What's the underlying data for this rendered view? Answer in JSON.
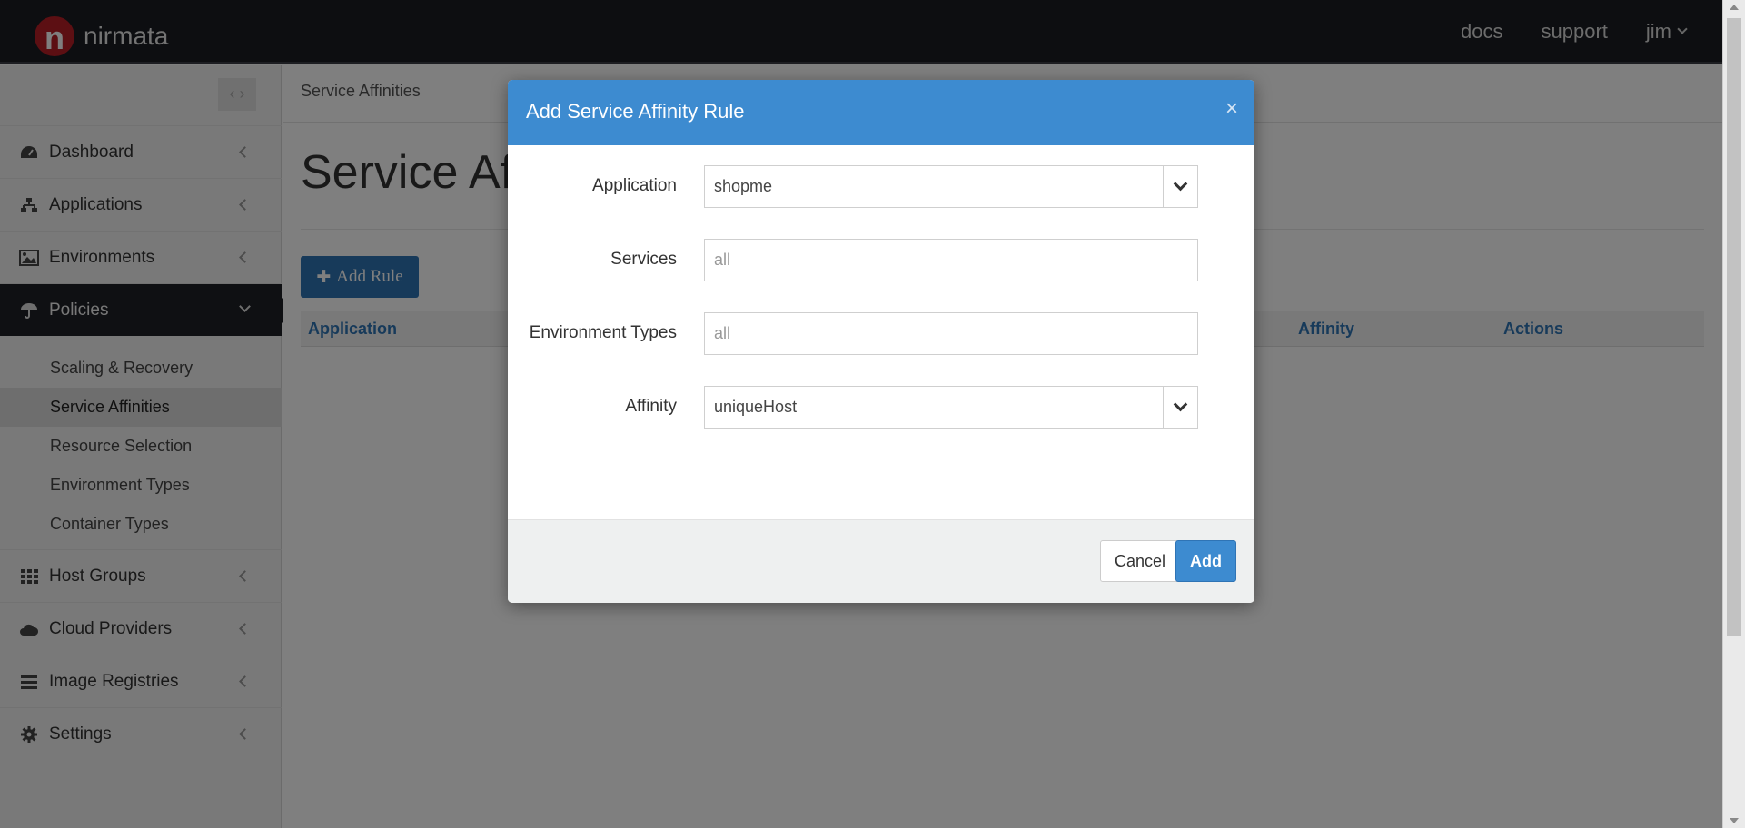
{
  "app": {
    "brand": "nirmata",
    "logo_letter": "n",
    "nav": {
      "docs": "docs",
      "support": "support",
      "user": "jim"
    }
  },
  "sidebar": {
    "collapse_label": "< >",
    "items": [
      {
        "label": "Dashboard",
        "icon": "dashboard-icon"
      },
      {
        "label": "Applications",
        "icon": "sitemap-icon"
      },
      {
        "label": "Environments",
        "icon": "image-icon"
      },
      {
        "label": "Policies",
        "icon": "umbrella-icon"
      },
      {
        "label": "Host Groups",
        "icon": "grid-icon"
      },
      {
        "label": "Cloud Providers",
        "icon": "cloud-icon"
      },
      {
        "label": "Image Registries",
        "icon": "list-icon"
      },
      {
        "label": "Settings",
        "icon": "gear-icon"
      }
    ],
    "policies_sub": [
      "Scaling & Recovery",
      "Service Affinities",
      "Resource Selection",
      "Environment Types",
      "Container Types"
    ]
  },
  "main": {
    "breadcrumb": "Service Affinities",
    "title": "Service Affinities",
    "add_rule_label": "Add Rule",
    "columns": [
      "Application",
      "Affinity",
      "Actions"
    ]
  },
  "modal": {
    "title": "Add Service Affinity Rule",
    "close": "×",
    "fields": {
      "application": {
        "label": "Application",
        "value": "shopme"
      },
      "services": {
        "label": "Services",
        "placeholder": "all"
      },
      "environment_types": {
        "label": "Environment Types",
        "placeholder": "all"
      },
      "affinity": {
        "label": "Affinity",
        "value": "uniqueHost"
      }
    },
    "cancel_label": "Cancel",
    "add_label": "Add"
  },
  "colors": {
    "accent": "#3d8bd0",
    "topbar": "#1b1d22",
    "logo": "#b81f26"
  }
}
